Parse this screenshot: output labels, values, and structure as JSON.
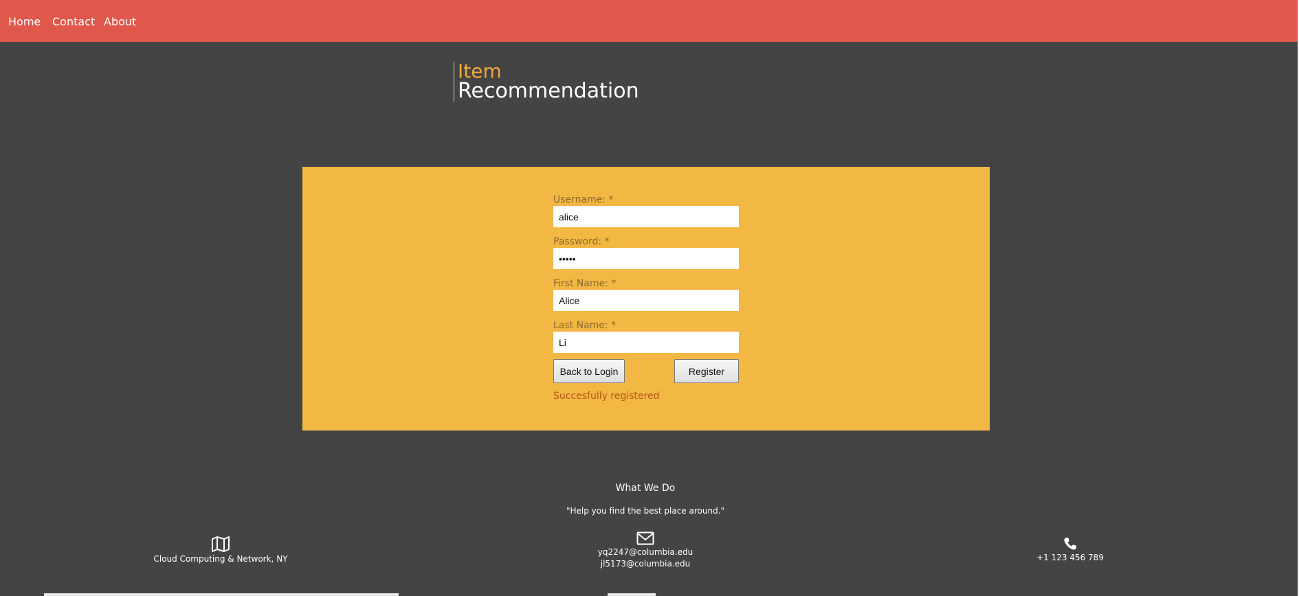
{
  "nav": {
    "items": [
      {
        "label": "Home"
      },
      {
        "label": "Contact"
      },
      {
        "label": "About"
      }
    ],
    "bg_color": "#E0584B"
  },
  "brand": {
    "line1": "Item",
    "line2": "Recommendation",
    "accent_color": "#F0A93A"
  },
  "register_form": {
    "panel_color": "#F2B843",
    "fields": {
      "username": {
        "label": "Username: *",
        "value": "alice"
      },
      "password": {
        "label": "Password: *",
        "value": "alice"
      },
      "first_name": {
        "label": "First Name: *",
        "value": "Alice"
      },
      "last_name": {
        "label": "Last Name: *",
        "value": "Li"
      }
    },
    "back_label": "Back to Login",
    "register_label": "Register",
    "status": "Succesfully registered"
  },
  "footer": {
    "title": "What We Do",
    "quote": "\"Help you find the best place around.\"",
    "location": {
      "icon": "map-icon",
      "text": "Cloud Computing & Network, NY"
    },
    "email": {
      "icon": "envelope-icon",
      "lines": [
        "yq2247@columbia.edu",
        "jl5173@columbia.edu"
      ]
    },
    "phone": {
      "icon": "phone-icon",
      "text": "+1 123 456 789"
    }
  }
}
